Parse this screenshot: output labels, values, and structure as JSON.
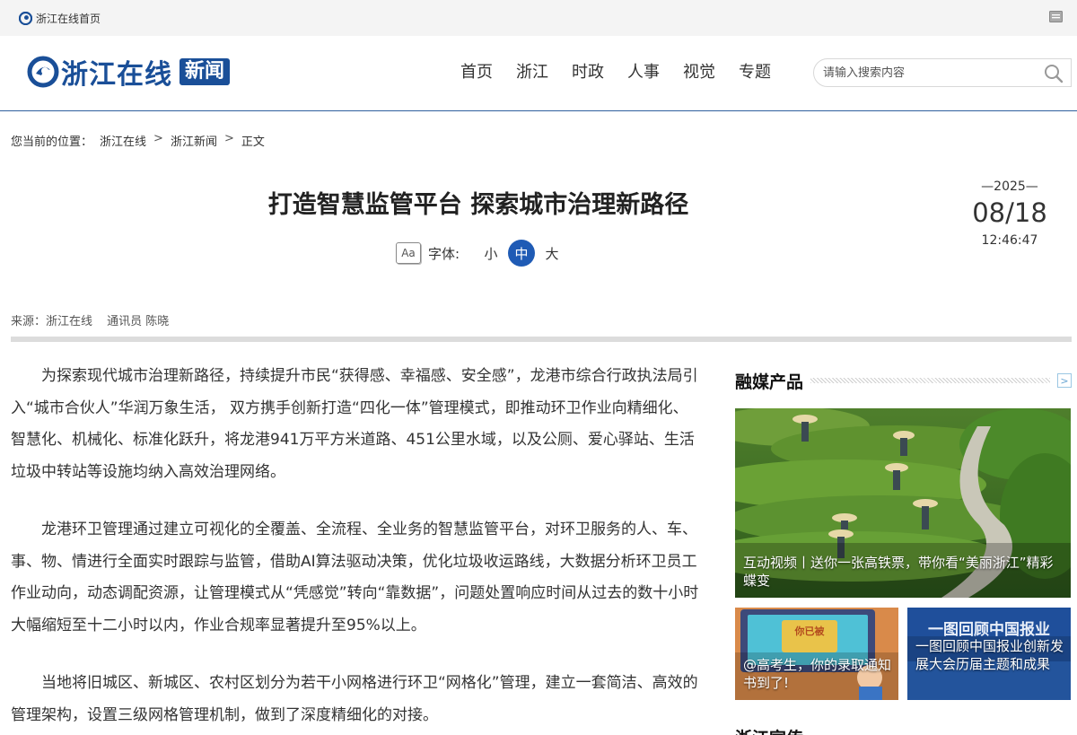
{
  "topbar": {
    "home_link": "浙江在线首页"
  },
  "header": {
    "brand_name": "浙江在线",
    "brand_tag": "新闻",
    "nav": [
      "首页",
      "浙江",
      "时政",
      "人事",
      "视觉",
      "专题"
    ],
    "search_placeholder": "请输入搜索内容"
  },
  "breadcrumb": {
    "label": "您当前的位置：",
    "items": [
      "浙江在线",
      "浙江新闻",
      "正文"
    ],
    "separator": ">"
  },
  "article": {
    "title": "打造智慧监管平台 探索城市治理新路径",
    "font_size": {
      "label": "字体:",
      "options": [
        "小",
        "中",
        "大"
      ],
      "selected": "中",
      "icon_text": "Aa"
    },
    "date": {
      "year": "—2025—",
      "month_day": "08/18",
      "time": "12:46:47"
    },
    "source": {
      "from": "来源：浙江在线",
      "author": "通讯员 陈晓"
    },
    "paragraphs": [
      "为探索现代城市治理新路径，持续提升市民“获得感、幸福感、安全感”，龙港市综合行政执法局引入“城市合伙人”华润万象生活， 双方携手创新打造“四化一体”管理模式，即推动环卫作业向精细化、智慧化、机械化、标准化跃升，将龙港941万平方米道路、451公里水域，以及公厕、爱心驿站、生活垃圾中转站等设施均纳入高效治理网络。",
      "龙港环卫管理通过建立可视化的全覆盖、全流程、全业务的智慧监管平台，对环卫服务的人、车、事、物、情进行全面实时跟踪与监管，借助AI算法驱动决策，优化垃圾收运路线，大数据分析环卫员工作业动向，动态调配资源，让管理模式从“凭感觉”转向“靠数据”，问题处置响应时间从过去的数十小时大幅缩短至十二小时以内，作业合规率显著提升至95%以上。",
      "当地将旧城区、新城区、农村区划分为若干小网格进行环卫“网格化”管理，建立一套简洁、高效的管理架构，设置三级网格管理机制，做到了深度精细化的对接。"
    ]
  },
  "sidebar": {
    "section_title": "融媒产品",
    "more_glyph": ">",
    "cards": [
      {
        "caption": "互动视频丨送你一张高铁票，带你看“美丽浙江”精彩蝶变"
      },
      {
        "caption": "@高考生，你的录取通知书到了!",
        "image_text": "你已被"
      },
      {
        "caption": "一图回顾中国报业创新发展大会历届主题和成果",
        "image_text": "一图回顾中国报业"
      }
    ],
    "next_section_title": "浙江宣传"
  },
  "colors": {
    "brand": "#1a4f98",
    "accent": "#1f5bb5"
  }
}
